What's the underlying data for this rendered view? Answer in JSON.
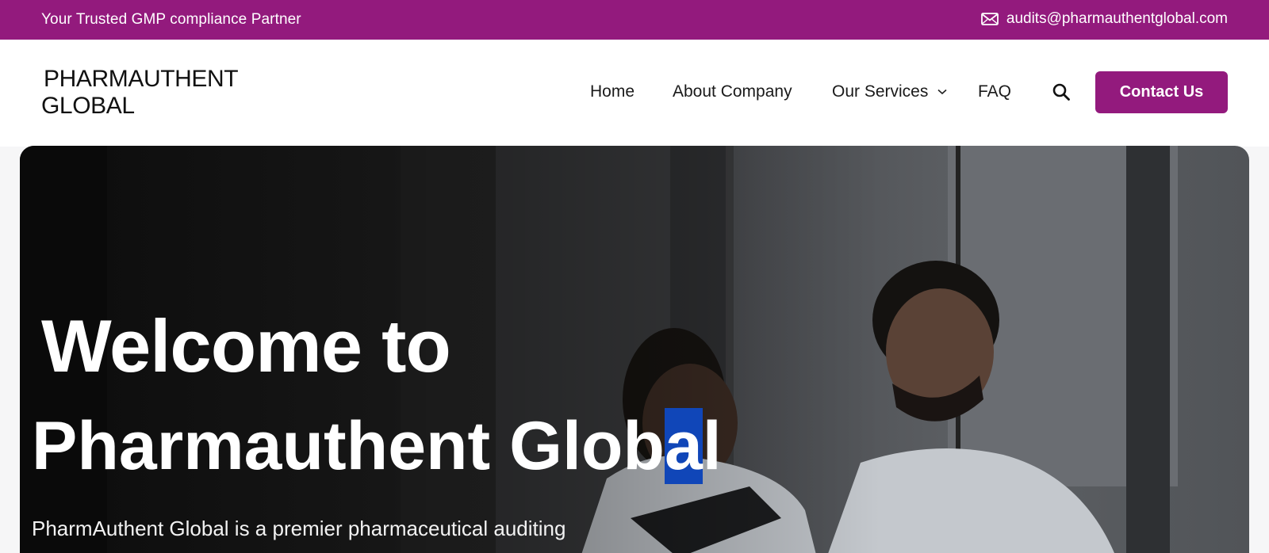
{
  "topbar": {
    "tagline": "Your Trusted GMP compliance Partner",
    "email": "audits@pharmauthentglobal.com",
    "email_icon": "mail-icon",
    "background": "#931a7d"
  },
  "header": {
    "logo_line1": "PHARMAUTHENT",
    "logo_line2": "GLOBAL",
    "nav": {
      "home": "Home",
      "about": "About Company",
      "services": "Our Services",
      "faq": "FAQ"
    },
    "search_icon": "search-icon",
    "contact_label": "Contact Us",
    "accent": "#931a7d"
  },
  "hero": {
    "heading_line1": "Welcome to",
    "heading_line2_part1": "Pharmauthent Glob",
    "heading_line2_selected": "a",
    "heading_line2_part2": "l",
    "description": "PharmAuthent Global is a premier pharmaceutical auditing",
    "selection_color": "#1046b8"
  }
}
